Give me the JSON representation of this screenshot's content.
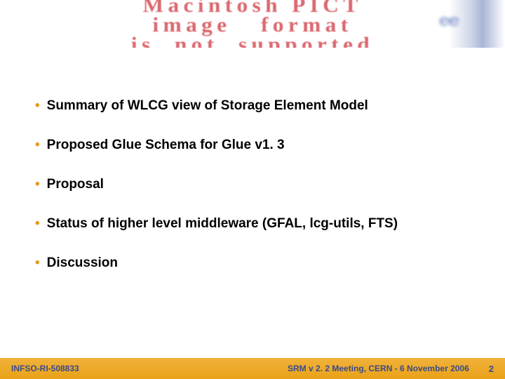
{
  "banner": {
    "line1": "Macintosh PICT",
    "line2": "image   format",
    "line3": "is  not  supported"
  },
  "bullets": [
    "Summary of WLCG view of Storage Element Model",
    "Proposed Glue Schema for Glue v1. 3",
    "Proposal",
    "Status of higher level middleware (GFAL, lcg-utils, FTS)",
    "Discussion"
  ],
  "footer": {
    "left": "INFSO-RI-508833",
    "center": "SRM v 2. 2 Meeting, CERN - 6 November 2006",
    "right": "2"
  }
}
